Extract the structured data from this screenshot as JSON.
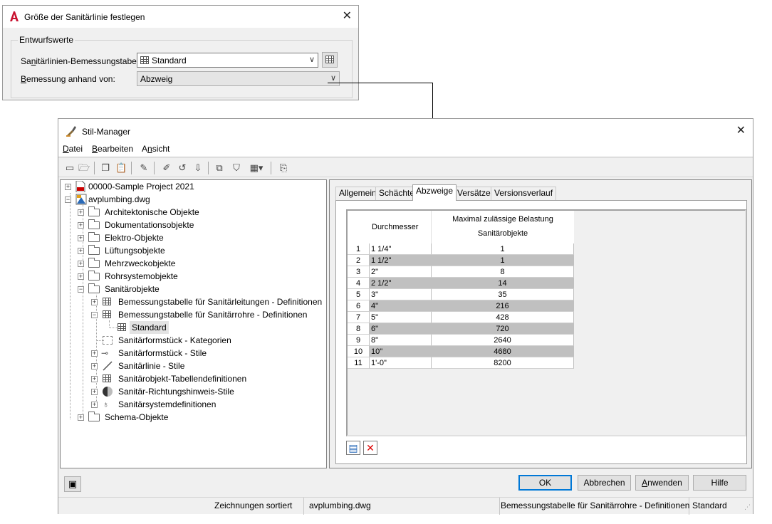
{
  "dialog1": {
    "title": "Größe der Sanitärlinie festlegen",
    "group_label": "Entwurfswerte",
    "table_label_pre": "Sa",
    "table_label_u": "n",
    "table_label_post": "itärlinien-Bemessungstabelle:",
    "table_value": "Standard",
    "basis_label_u": "B",
    "basis_label_post": "emessung anhand von:",
    "basis_value": "Abzweig"
  },
  "dialog2": {
    "title": "Stil-Manager",
    "menu": [
      {
        "u": "D",
        "rest": "atei"
      },
      {
        "u": "B",
        "rest": "earbeiten"
      },
      {
        "pre": "A",
        "u": "n",
        "rest": "sicht"
      }
    ],
    "tree": {
      "project": "00000-Sample Project 2021",
      "drawing": "avplumbing.dwg",
      "categories": [
        "Architektonische Objekte",
        "Dokumentationsobjekte",
        "Elektro-Objekte",
        "Lüftungsobjekte",
        "Mehrzweckobjekte",
        "Rohrsystemobjekte",
        "Sanitärobjekte"
      ],
      "sanitary_children": [
        "Bemessungstabelle für Sanitärleitungen - Definitionen",
        "Bemessungstabelle für Sanitärrohre - Definitionen",
        "Standard",
        "Sanitärformstück - Kategorien",
        "Sanitärformstück - Stile",
        "Sanitärlinie - Stile",
        "Sanitärobjekt-Tabellendefinitionen",
        "Sanitär-Richtungshinweis-Stile",
        "Sanitärsystemdefinitionen"
      ],
      "last": "Schema-Objekte"
    },
    "tabs": [
      "Allgemein",
      "Schächte",
      "Abzweige",
      "Versätze",
      "Versionsverlauf"
    ],
    "active_tab": "Abzweige",
    "grid": {
      "col_diameter": "Durchmesser",
      "col_load_line1": "Maximal zulässige Belastung",
      "col_load_line2": "Sanitärobjekte",
      "rows": [
        {
          "n": "1",
          "d": "1 1/4\"",
          "v": "1"
        },
        {
          "n": "2",
          "d": "1 1/2\"",
          "v": "1"
        },
        {
          "n": "3",
          "d": "2\"",
          "v": "8"
        },
        {
          "n": "4",
          "d": "2 1/2\"",
          "v": "14"
        },
        {
          "n": "5",
          "d": "3\"",
          "v": "35"
        },
        {
          "n": "6",
          "d": "4\"",
          "v": "216"
        },
        {
          "n": "7",
          "d": "5\"",
          "v": "428"
        },
        {
          "n": "8",
          "d": "6\"",
          "v": "720"
        },
        {
          "n": "9",
          "d": "8\"",
          "v": "2640"
        },
        {
          "n": "10",
          "d": "10\"",
          "v": "4680"
        },
        {
          "n": "11",
          "d": "1'-0\"",
          "v": "8200"
        }
      ]
    },
    "buttons": {
      "ok": "OK",
      "cancel": "Abbrechen",
      "apply_u": "A",
      "apply_rest": "nwenden",
      "help": "Hilfe"
    },
    "status": {
      "sorted": "Zeichnungen sortiert",
      "file": "avplumbing.dwg",
      "definition": "Bemessungstabelle für Sanitärrohre - Definitionen",
      "style": "Standard"
    }
  }
}
